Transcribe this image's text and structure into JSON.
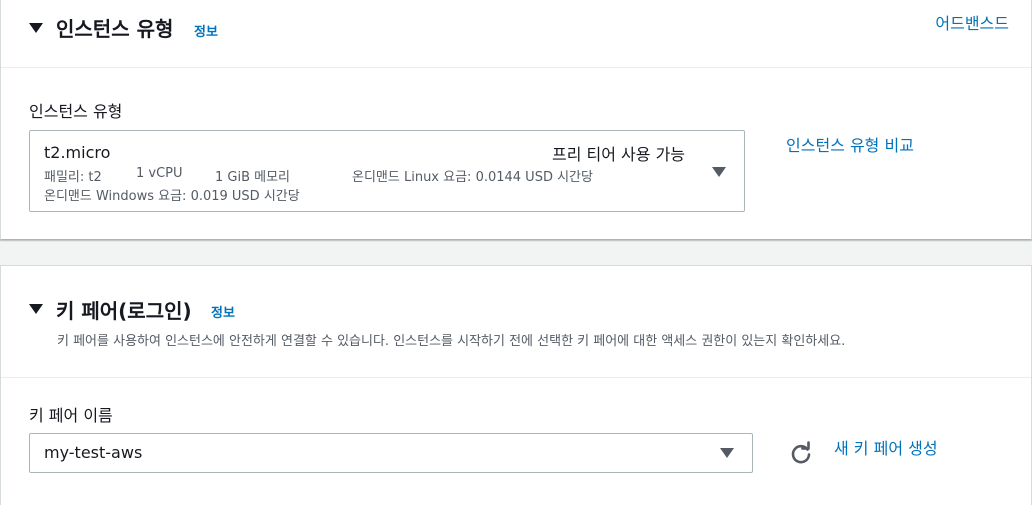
{
  "instance_type_section": {
    "title": "인스턴스 유형",
    "info_link": "정보",
    "advanced_link": "어드밴스드",
    "field_label": "인스턴스 유형",
    "selected": {
      "name": "t2.micro",
      "free_tier": "프리 티어 사용 가능",
      "family": "패밀리: t2",
      "vcpu": "1 vCPU",
      "memory": "1 GiB 메모리",
      "linux_price": "온디맨드 Linux 요금: 0.0144 USD 시간당",
      "windows_price": "온디맨드 Windows 요금: 0.019 USD 시간당"
    },
    "compare_link": "인스턴스 유형 비교"
  },
  "key_pair_section": {
    "title": "키 페어(로그인)",
    "info_link": "정보",
    "description": "키 페어를 사용하여 인스턴스에 안전하게 연결할 수 있습니다. 인스턴스를 시작하기 전에 선택한 키 페어에 대한 액세스 권한이 있는지 확인하세요.",
    "field_label": "키 페어 이름",
    "selected_value": "my-test-aws",
    "create_link": "새 키 페어 생성"
  },
  "colors": {
    "link": "#0073bb",
    "text": "#16191f",
    "secondary_text": "#545b64",
    "border": "#aab7b8",
    "background": "#f2f3f3"
  },
  "icons": {
    "collapse": "caret-down-icon",
    "dropdown": "caret-down-icon",
    "refresh": "refresh-icon"
  }
}
